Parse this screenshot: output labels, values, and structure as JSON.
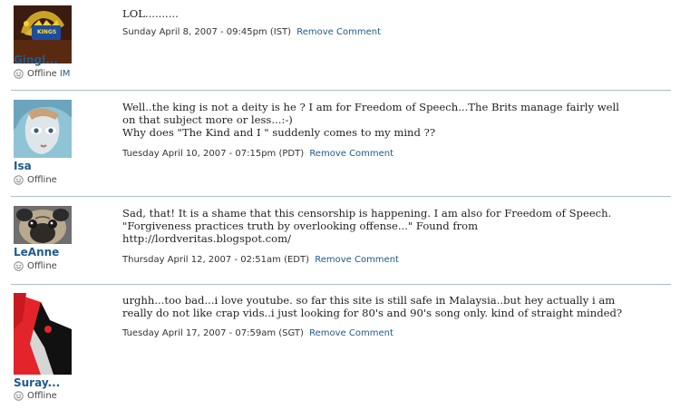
{
  "comments": [
    {
      "username": "Gingl...",
      "status": "Offline",
      "status_link": "IM",
      "text": "LOL..........",
      "timestamp": "Sunday April 8, 2007 - 09:45pm (IST)",
      "remove_label": "Remove Comment",
      "avatar_label": "KINGS"
    },
    {
      "username": "Isa",
      "status": "Offline",
      "text": "Well..the king is not a deity is he ? I am for Freedom of Speech...The Brits manage fairly well\non that subject more or less...:-)\nWhy does \"The Kind and I \" suddenly comes to my mind ??",
      "timestamp": "Tuesday April 10, 2007 - 07:15pm (PDT)",
      "remove_label": "Remove Comment"
    },
    {
      "username": "LeAnne",
      "status": "Offline",
      "text": "Sad, that! It is a shame that this censorship is happening. I am also for Freedom of Speech.\n\"Forgiveness practices truth by overlooking offense...\" Found from\nhttp://lordveritas.blogspot.com/",
      "timestamp": "Thursday April 12, 2007 - 02:51am (EDT)",
      "remove_label": "Remove Comment"
    },
    {
      "username": "Suray...",
      "status": "Offline",
      "text": "urghh...too bad...i love youtube. so far this site is still safe in Malaysia..but hey actually i am\nreally do not like crap vids..i just looking for 80's and 90's song only. kind of straight minded?",
      "timestamp": "Tuesday April 17, 2007 - 07:59am (SGT)",
      "remove_label": "Remove Comment"
    }
  ],
  "colors": {
    "link": "#1d5a8c",
    "divider": "#a9bfd1",
    "text": "#222222"
  },
  "icons": {
    "presence": "smiley-icon"
  }
}
